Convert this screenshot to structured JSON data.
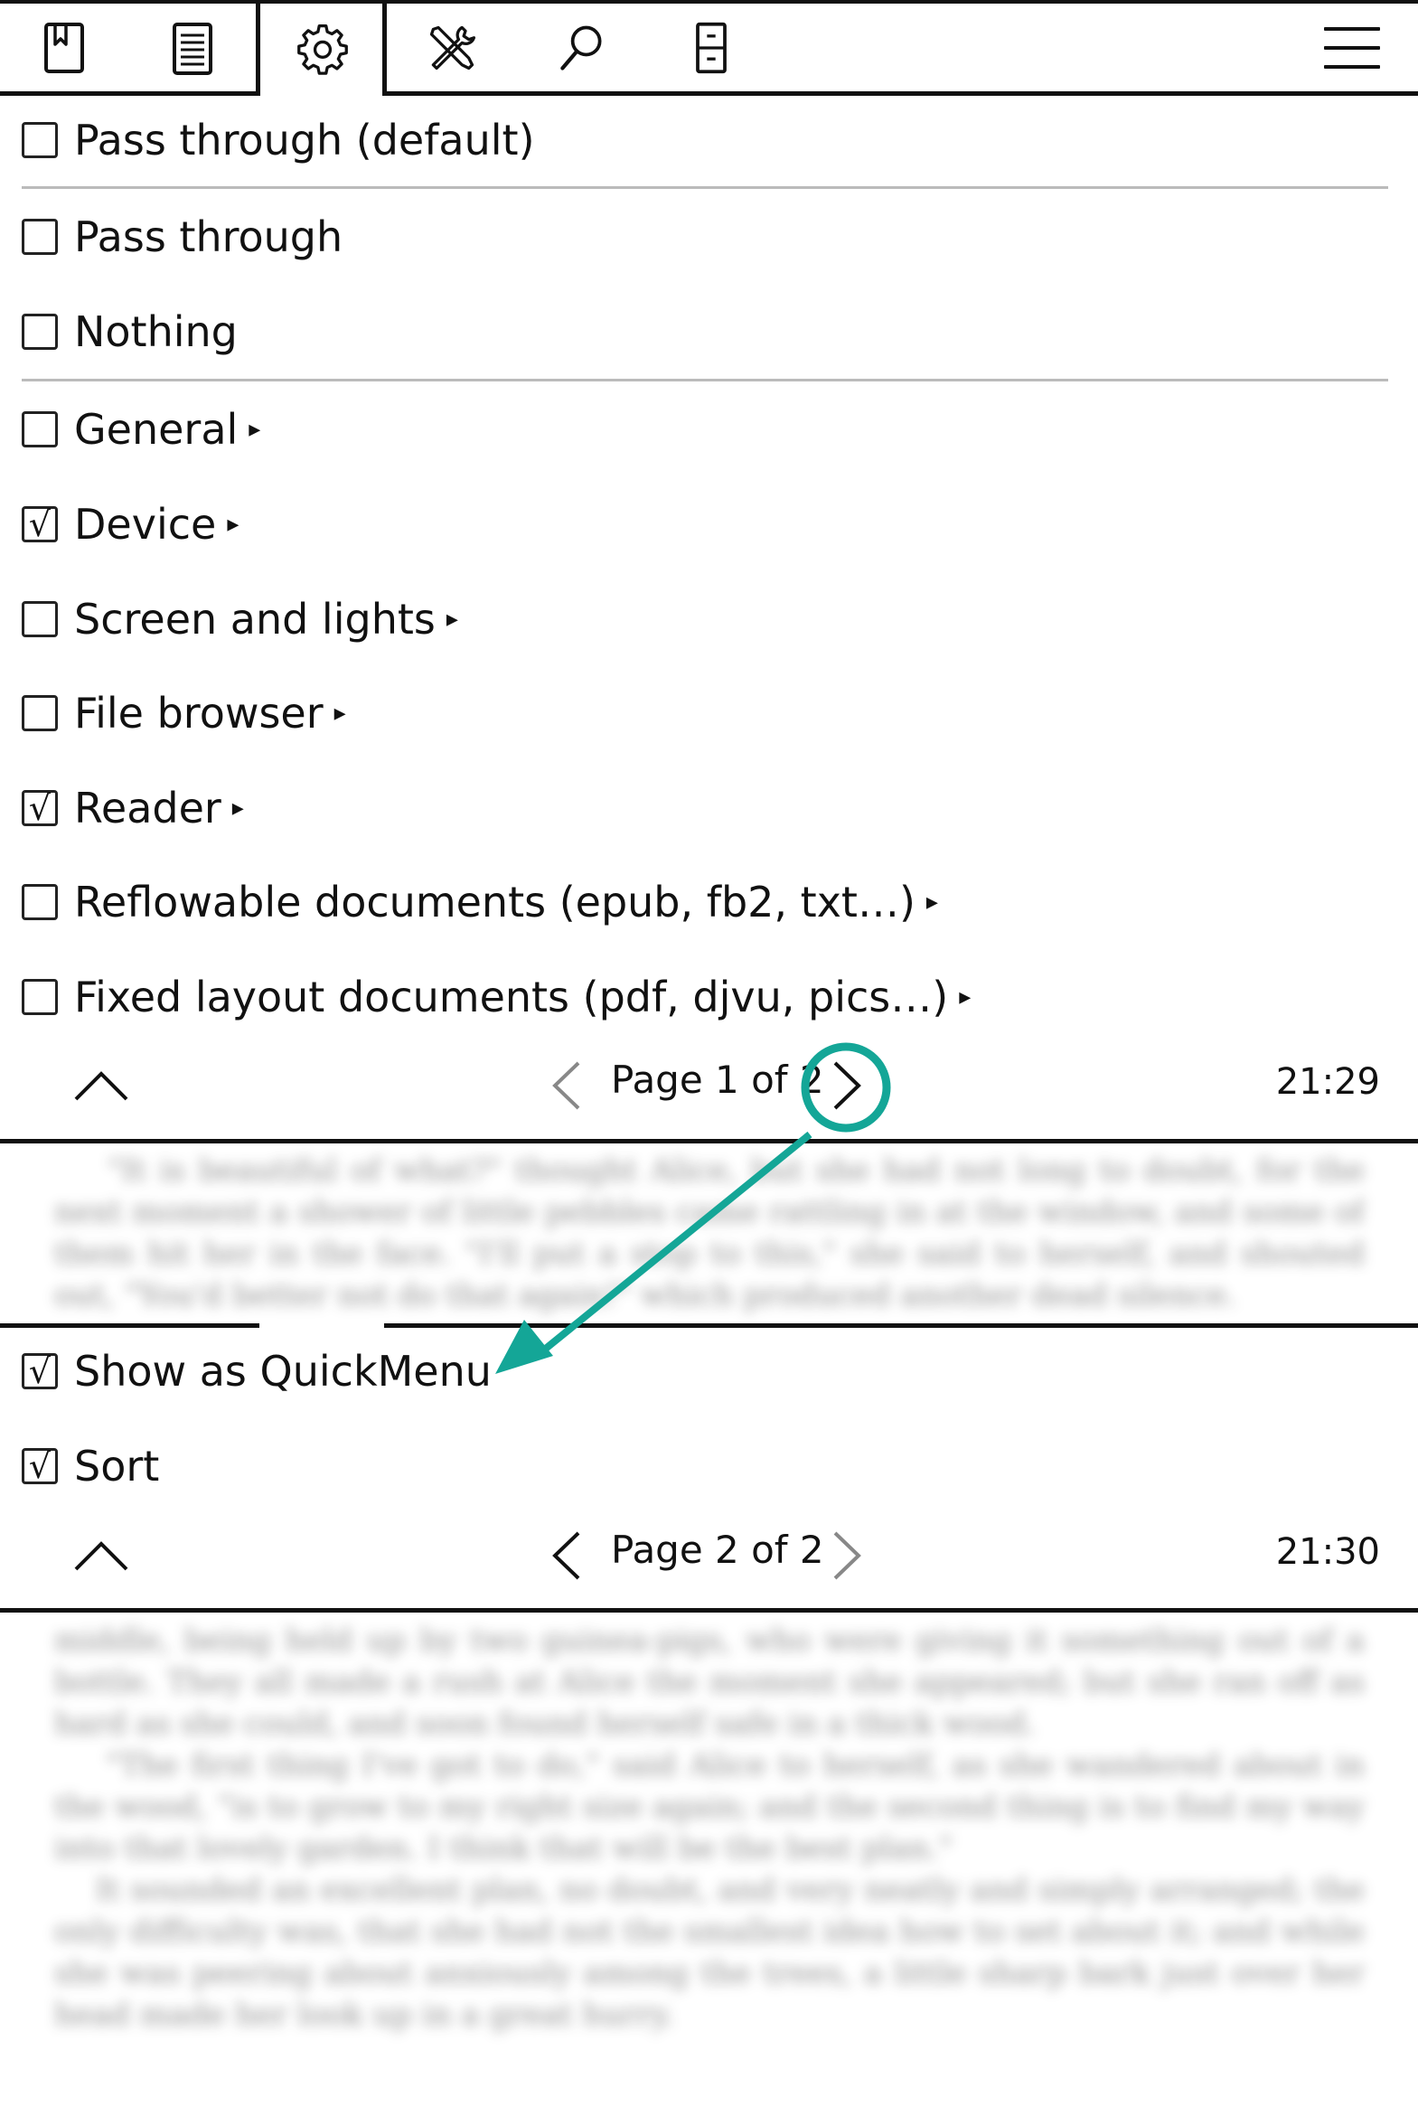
{
  "tabs": [
    {
      "id": "bookmark",
      "icon": "bookmark-icon"
    },
    {
      "id": "toc",
      "icon": "document-list-icon"
    },
    {
      "id": "settings",
      "icon": "gear-icon",
      "active": true
    },
    {
      "id": "tools",
      "icon": "tools-icon"
    },
    {
      "id": "search",
      "icon": "search-icon"
    },
    {
      "id": "filing",
      "icon": "filing-cabinet-icon"
    }
  ],
  "menu_icon": "hamburger-menu-icon",
  "page1": {
    "items": [
      {
        "label": "Pass through (default)",
        "checked": false,
        "submenu": false
      },
      {
        "label": "Pass through",
        "checked": false,
        "submenu": false
      },
      {
        "label": "Nothing",
        "checked": false,
        "submenu": false
      },
      {
        "label": "General",
        "checked": false,
        "submenu": true
      },
      {
        "label": "Device",
        "checked": true,
        "submenu": true
      },
      {
        "label": "Screen and lights",
        "checked": false,
        "submenu": true
      },
      {
        "label": "File browser",
        "checked": false,
        "submenu": true
      },
      {
        "label": "Reader",
        "checked": true,
        "submenu": true
      },
      {
        "label": "Reflowable documents (epub, fb2, txt…)",
        "checked": false,
        "submenu": true
      },
      {
        "label": "Fixed layout documents (pdf, djvu, pics…)",
        "checked": false,
        "submenu": true
      }
    ],
    "footer": {
      "page_label": "Page 1 of 2",
      "time": "21:29"
    }
  },
  "page2": {
    "items": [
      {
        "label": "Show as QuickMenu",
        "checked": true,
        "submenu": false
      },
      {
        "label": "Sort",
        "checked": true,
        "submenu": false
      }
    ],
    "footer": {
      "page_label": "Page 2 of 2",
      "time": "21:30"
    }
  },
  "check_mark": "√",
  "submenu_arrow": "▸",
  "annotation_color": "#14a697"
}
